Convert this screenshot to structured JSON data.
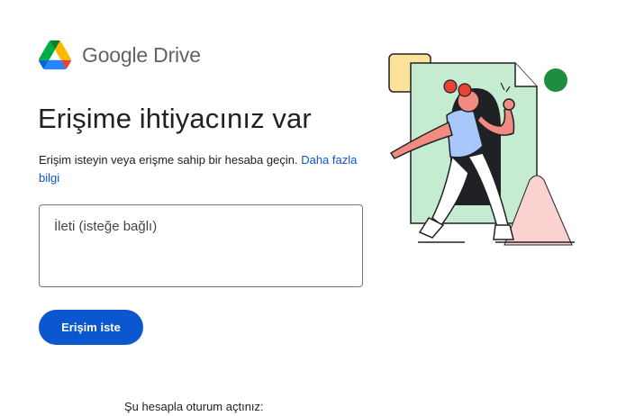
{
  "brand": {
    "name": "Google Drive",
    "logo_icon": "google-drive-logo",
    "colors": {
      "green": "#0f9d58",
      "yellow": "#fbbc04",
      "blue": "#4285f4",
      "darkgreen": "#188038"
    }
  },
  "main": {
    "title": "Erişime ihtiyacınız var",
    "description": "Erişim isteyin veya erişme sahip bir hesaba geçin.",
    "learn_more": "Daha fazla bilgi",
    "message_placeholder": "İleti (isteğe bağlı)",
    "request_button": "Erişim iste"
  },
  "footer": {
    "signed_in_text": "Şu hesapla oturum açtınız:"
  },
  "colors": {
    "accent": "#0b57d0",
    "text": "#202124",
    "border": "#747775"
  }
}
